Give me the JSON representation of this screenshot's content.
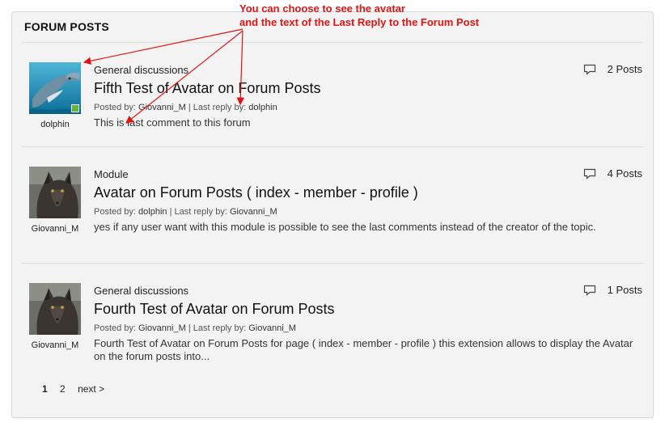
{
  "panel": {
    "title": "FORUM POSTS"
  },
  "annotation": {
    "line1": "You can choose to see the avatar",
    "line2": "and the text of the Last Reply to the Forum Post",
    "color": "#e11414"
  },
  "posts": [
    {
      "avatar_name": "dolphin",
      "avatar_icon": "dolphin-avatar",
      "online": true,
      "category": "General discussions",
      "title": "Fifth Test of Avatar on Forum Posts",
      "posted_by_label": "Posted by:",
      "posted_by": "Giovanni_M",
      "last_reply_label": "Last reply by:",
      "last_reply_by": "dolphin",
      "excerpt": "This is last comment to this forum",
      "posts_count": "2 Posts"
    },
    {
      "avatar_name": "Giovanni_M",
      "avatar_icon": "wolf-avatar",
      "online": false,
      "category": "Module",
      "title": "Avatar on Forum Posts ( index - member - profile )",
      "posted_by_label": "Posted by:",
      "posted_by": "dolphin",
      "last_reply_label": "Last reply by:",
      "last_reply_by": "Giovanni_M",
      "excerpt": "yes if any user want with this module is possible to see the last comments instead of the creator of the topic.",
      "posts_count": "4 Posts"
    },
    {
      "avatar_name": "Giovanni_M",
      "avatar_icon": "wolf-avatar",
      "online": false,
      "category": "General discussions",
      "title": "Fourth Test of Avatar on Forum Posts",
      "posted_by_label": "Posted by:",
      "posted_by": "Giovanni_M",
      "last_reply_label": "Last reply by:",
      "last_reply_by": "Giovanni_M",
      "excerpt": "Fourth Test of Avatar on Forum Posts for page ( index - member - profile ) this extension allows to display the Avatar on the forum posts into...",
      "posts_count": "1 Posts"
    }
  ],
  "pagination": {
    "pages": [
      "1",
      "2"
    ],
    "current": "1",
    "next_label": "next >"
  }
}
